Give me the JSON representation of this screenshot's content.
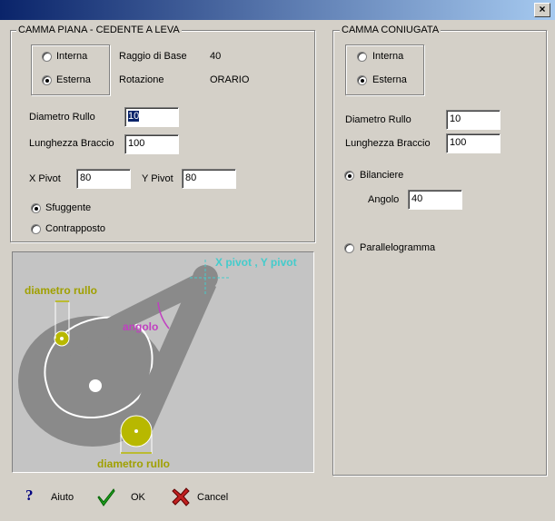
{
  "window": {
    "close_label": "×"
  },
  "left_group": {
    "title": "CAMMA PIANA - CEDENTE A LEVA",
    "type_options": [
      {
        "label": "Interna",
        "selected": false
      },
      {
        "label": "Esterna",
        "selected": true
      }
    ],
    "raggio_label": "Raggio di Base",
    "raggio_value": "40",
    "rotazione_label": "Rotazione",
    "rotazione_value": "ORARIO",
    "diametro_label": "Diametro Rullo",
    "diametro_value": "10",
    "lunghezza_label": "Lunghezza Braccio",
    "lunghezza_value": "100",
    "xpivot_label": "X Pivot",
    "xpivot_value": "80",
    "ypivot_label": "Y Pivot",
    "ypivot_value": "80",
    "follower_options": [
      {
        "label": "Sfuggente",
        "selected": true
      },
      {
        "label": "Contrapposto",
        "selected": false
      }
    ]
  },
  "diagram": {
    "pivot_label": "X pivot , Y pivot",
    "angle_label": "angolo",
    "roller_top_label": "diametro rullo",
    "roller_bottom_label": "diametro rullo",
    "colors": {
      "background": "#c4c4c4",
      "body": "#8a8a8a",
      "outline": "#ffffff",
      "roller": "#b8b800",
      "roller_label": "#a0a000",
      "pivot_label": "#44cccc",
      "angle": "#c040c0"
    }
  },
  "right_group": {
    "title": "CAMMA CONIUGATA",
    "type_options": [
      {
        "label": "Interna",
        "selected": false
      },
      {
        "label": "Esterna",
        "selected": true
      }
    ],
    "diametro_label": "Diametro Rullo",
    "diametro_value": "10",
    "lunghezza_label": "Lunghezza Braccio",
    "lunghezza_value": "100",
    "bilanciere_label": "Bilanciere",
    "bilanciere_selected": true,
    "angolo_label": "Angolo",
    "angolo_value": "40",
    "parallelogramma_label": "Parallelogramma",
    "parallelogramma_selected": false
  },
  "buttons": {
    "help_label": "Aiuto",
    "ok_label": "OK",
    "cancel_label": "Cancel"
  }
}
